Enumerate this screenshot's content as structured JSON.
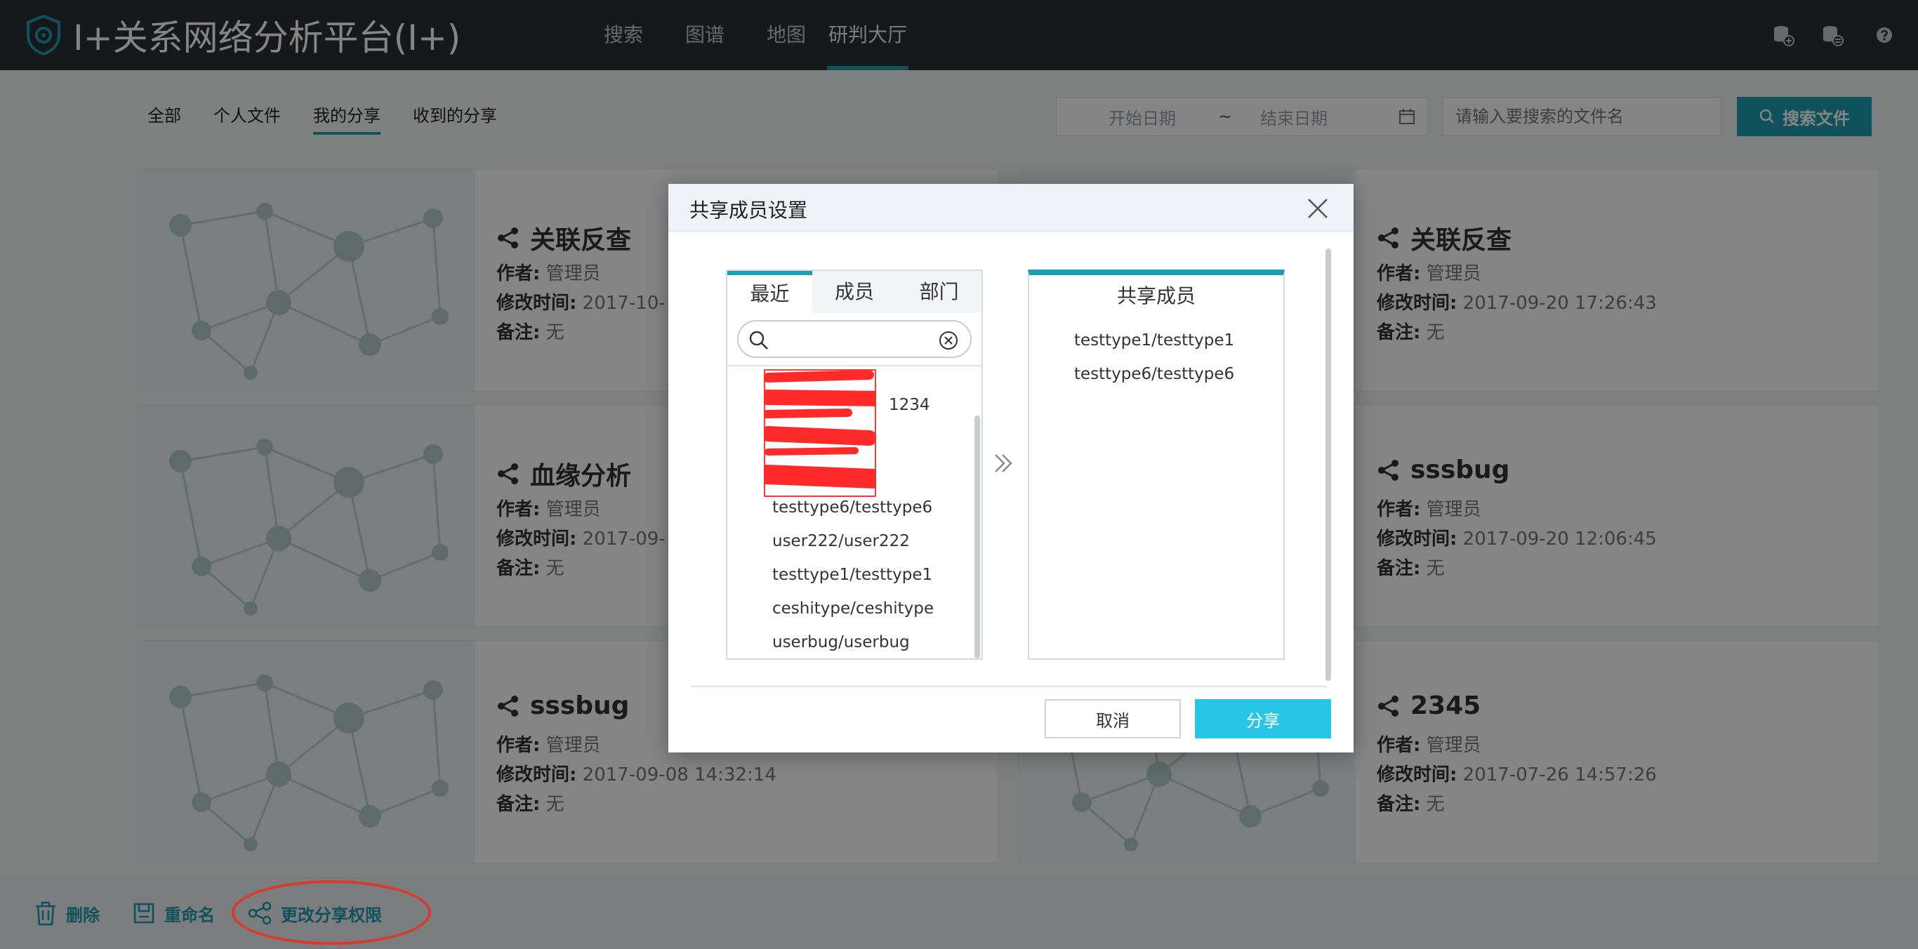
{
  "header": {
    "app_title": "I+关系网络分析平台(I+)",
    "nav": [
      "搜索",
      "图谱",
      "地图",
      "研判大厅"
    ],
    "active_nav": "研判大厅"
  },
  "subnav": {
    "tabs": [
      "全部",
      "个人文件",
      "我的分享",
      "收到的分享"
    ],
    "active": "我的分享"
  },
  "filters": {
    "start_date_placeholder": "开始日期",
    "separator": "~",
    "end_date_placeholder": "结束日期",
    "search_placeholder": "请输入要搜索的文件名",
    "search_button": "搜索文件"
  },
  "labels": {
    "author": "作者:",
    "modified": "修改时间:",
    "note": "备注:"
  },
  "cards": [
    {
      "title": "关联反查",
      "author": "管理员",
      "modified": "2017-10-",
      "note": "无"
    },
    {
      "title": "关联反查",
      "author": "管理员",
      "modified": "2017-09-20 17:26:43",
      "note": "无"
    },
    {
      "title": "血缘分析",
      "author": "管理员",
      "modified": "2017-09-",
      "note": "无"
    },
    {
      "title": "sssbug",
      "author": "管理员",
      "modified": "2017-09-20 12:06:45",
      "note": "无"
    },
    {
      "title": "sssbug",
      "author": "管理员",
      "modified": "2017-09-08 14:32:14",
      "note": "无"
    },
    {
      "title": "2345",
      "author": "管理员",
      "modified": "2017-07-26 14:57:26",
      "note": "无"
    }
  ],
  "bottom_bar": {
    "delete": "删除",
    "rename": "重命名",
    "change_share": "更改分享权限"
  },
  "dialog": {
    "title": "共享成员设置",
    "tabs": [
      "最近",
      "成员",
      "部门"
    ],
    "active_tab": "最近",
    "search_value": "",
    "partial_item": "1234",
    "candidates": [
      "testtype6/testtype6",
      "user222/user222",
      "testtype1/testtype1",
      "ceshitype/ceshitype",
      "userbug/userbug"
    ],
    "shared_title": "共享成员",
    "shared": [
      "testtype1/testtype1",
      "testtype6/testtype6"
    ],
    "cancel": "取消",
    "confirm": "分享"
  },
  "colors": {
    "header_bg": "#2b2f33",
    "accent": "#1e9db1",
    "share_button": "#29c5e6",
    "annotation": "#d93a2b"
  }
}
